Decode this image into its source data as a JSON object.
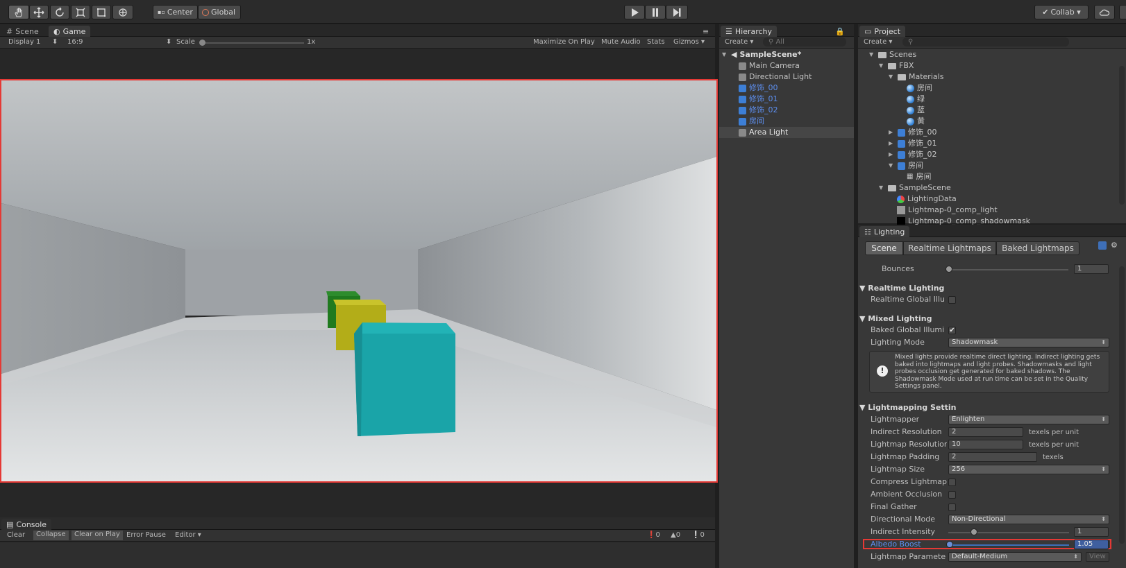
{
  "toolbar": {
    "tools": [
      "hand-tool-icon",
      "move-tool-icon",
      "rotate-tool-icon",
      "scale-tool-icon",
      "rect-tool-icon",
      "transform-tool-icon"
    ],
    "pivot_label": "Center",
    "space_label": "Global",
    "collab_label": "Collab ▾"
  },
  "scene_panel": {
    "tabs": [
      {
        "label": "Scene",
        "icon": "grid-icon",
        "active": false
      },
      {
        "label": "Game",
        "icon": "game-icon",
        "active": true
      }
    ],
    "display": "Display 1",
    "aspect": "16:9",
    "scale_label": "Scale",
    "scale_value": "1x",
    "maximize": "Maximize On Play",
    "mute": "Mute Audio",
    "stats": "Stats",
    "gizmos": "Gizmos ▾"
  },
  "console": {
    "tab": "Console",
    "buttons": [
      "Clear",
      "Collapse",
      "Clear on Play",
      "Error Pause",
      "Editor ▾"
    ],
    "counts": {
      "errors": "0",
      "warnings": "0",
      "messages": "0"
    }
  },
  "hierarchy": {
    "tab": "Hierarchy",
    "create": "Create ▾",
    "search_placeholder": "All",
    "scene": "SampleScene*",
    "items": [
      {
        "label": "Main Camera",
        "prefab": false,
        "selected": false
      },
      {
        "label": "Directional Light",
        "prefab": false,
        "selected": false
      },
      {
        "label": "修饰_00",
        "prefab": true,
        "selected": false
      },
      {
        "label": "修饰_01",
        "prefab": true,
        "selected": false
      },
      {
        "label": "修饰_02",
        "prefab": true,
        "selected": false
      },
      {
        "label": "房间",
        "prefab": true,
        "selected": false
      },
      {
        "label": "Area Light",
        "prefab": false,
        "selected": true
      }
    ]
  },
  "project": {
    "tab": "Project",
    "create": "Create ▾",
    "tree": [
      {
        "label": "Scenes",
        "icon": "folder-icon",
        "open": true
      },
      {
        "label": "FBX",
        "icon": "folder-icon",
        "open": true
      },
      {
        "label": "Materials",
        "icon": "folder-icon",
        "open": true
      },
      {
        "label": "房间",
        "icon": "material-icon"
      },
      {
        "label": "绿",
        "icon": "material-icon"
      },
      {
        "label": "蓝",
        "icon": "material-icon"
      },
      {
        "label": "黄",
        "icon": "material-icon"
      },
      {
        "label": "修饰_00",
        "icon": "model-icon",
        "open": false
      },
      {
        "label": "修饰_01",
        "icon": "model-icon",
        "open": false
      },
      {
        "label": "修饰_02",
        "icon": "model-icon",
        "open": false
      },
      {
        "label": "房间",
        "icon": "model-icon",
        "open": true
      },
      {
        "label": "房间",
        "icon": "mesh-icon"
      },
      {
        "label": "SampleScene",
        "icon": "folder-icon",
        "open": true
      },
      {
        "label": "LightingData",
        "icon": "lighting-data-icon"
      },
      {
        "label": "Lightmap-0_comp_light",
        "icon": "texture-icon"
      },
      {
        "label": "Lightmap-0_comp_shadowmask",
        "icon": "texture-dark-icon"
      }
    ]
  },
  "lighting": {
    "tab": "Lighting",
    "subtabs": [
      {
        "label": "Scene",
        "active": true
      },
      {
        "label": "Realtime Lightmaps",
        "active": false
      },
      {
        "label": "Baked Lightmaps",
        "active": false
      }
    ],
    "bounces_label": "Bounces",
    "bounces_value": "1",
    "realtime_header": "Realtime Lighting",
    "realtime_gi_label": "Realtime Global Illu",
    "mixed_header": "Mixed Lighting",
    "baked_gi_label": "Baked Global Illumi",
    "lighting_mode_label": "Lighting Mode",
    "lighting_mode_value": "Shadowmask",
    "info_text": "Mixed lights provide realtime direct lighting. Indirect lighting gets baked into lightmaps and light probes. Shadowmasks and light probes occlusion get generated for baked shadows. The Shadowmask Mode used at run time can be set in the Quality Settings panel.",
    "lm_header": "Lightmapping Settin",
    "lightmapper_label": "Lightmapper",
    "lightmapper_value": "Enlighten",
    "indirect_res_label": "Indirect Resolution",
    "indirect_res_value": "2",
    "texels_per_unit": "texels per unit",
    "lm_res_label": "Lightmap Resolution",
    "lm_res_value": "10",
    "lm_padding_label": "Lightmap Padding",
    "lm_padding_value": "2",
    "texels": "texels",
    "lm_size_label": "Lightmap Size",
    "lm_size_value": "256",
    "compress_label": "Compress Lightmaps",
    "ao_label": "Ambient Occlusion",
    "final_gather_label": "Final Gather",
    "dir_mode_label": "Directional Mode",
    "dir_mode_value": "Non-Directional",
    "indirect_intensity_label": "Indirect Intensity",
    "indirect_intensity_value": "1",
    "albedo_label": "Albedo Boost",
    "albedo_value": "1.05",
    "lm_params_label": "Lightmap Paramete",
    "lm_params_value": "Default-Medium",
    "view_label": "View"
  },
  "colors": {
    "highlight_red": "#e53935",
    "prefab_blue": "#5d8ff0",
    "cube_cyan": "#1aa4a8",
    "cube_yellow": "#b3ad18",
    "cube_green": "#1f7a1f"
  }
}
